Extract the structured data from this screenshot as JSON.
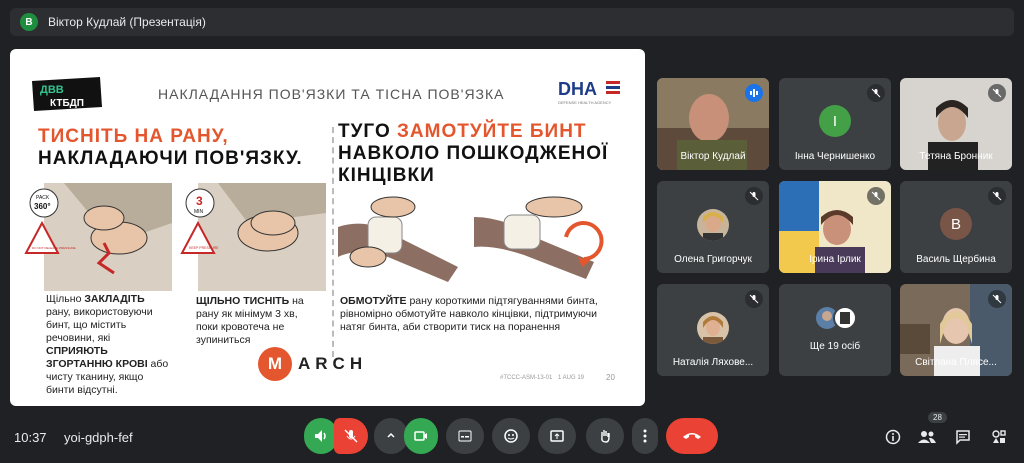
{
  "header": {
    "avatar_letter": "В",
    "title": "Віктор Кудлай (Презентація)"
  },
  "slide": {
    "logo_dvv_line1": "ДВВ",
    "logo_dvv_line2": "КТБДП",
    "title": "НАКЛАДАННЯ ПОВ'ЯЗКИ ТА ТІСНА ПОВ'ЯЗКА",
    "dha_logo": "DHA",
    "dha_sub": "DEFENSE HEALTH AGENCY",
    "left_heading_red": "ТИСНІТЬ НА РАНУ,",
    "left_heading_black": "НАКЛАДАЮЧИ ПОВ'ЯЗКУ.",
    "right_heading_black1": "ТУГО",
    "right_heading_red": "ЗАМОТУЙТЕ БИНТ",
    "right_heading_black2": "НАВКОЛО ПОШКОДЖЕНОЇ КІНЦІВКИ",
    "badge_pack": "PACK",
    "badge_360": "360°",
    "badge_3": "3",
    "badge_min": "MIN",
    "warn_left": "DO NOT RELEASE PRESSURE",
    "warn_right": "KEEP PRESSURE",
    "text1_a": "Щільно",
    "text1_b": "ЗАКЛАДІТЬ",
    "text1_c": "рану, використовуючи бинт, що містить речовини, які",
    "text1_d": "СПРИЯЮТЬ ЗГОРТАННЮ КРОВІ",
    "text1_e": "або чисту тканину, якщо бинти відсутні.",
    "text2_a": "ЩІЛЬНО ТИСНІТЬ",
    "text2_b": "на рану як мінімум 3 хв, поки кровотеча не зупиниться",
    "text3_a": "ОБМОТУЙТЕ",
    "text3_b": "рану короткими підтягуваннями бинта, рівномірно обмотуйте навколо кінцівки, підтримуючи натяг бинта, аби створити тиск на поранення",
    "march_m": "M",
    "march_rest": "ARCH",
    "footer_code": "#TCCC-ASM-13-01",
    "footer_date": "1 AUG 19",
    "page_number": "20"
  },
  "participants": [
    {
      "name": "Віктор Кудлай",
      "type": "video"
    },
    {
      "name": "Інна Чернишенко",
      "type": "letter",
      "letter": "І",
      "color": "#43a047"
    },
    {
      "name": "Тетяна Бронник",
      "type": "video"
    },
    {
      "name": "Олена Григорчук",
      "type": "photo"
    },
    {
      "name": "Ірина Ірлик",
      "type": "video"
    },
    {
      "name": "Василь Щербина",
      "type": "letter",
      "letter": "В",
      "color": "#795548"
    },
    {
      "name": "Наталія Ляхове...",
      "type": "photo"
    },
    {
      "name": "Ще 19 осіб",
      "type": "more"
    },
    {
      "name": "Світлана Плясе...",
      "type": "video"
    }
  ],
  "bottom": {
    "time": "10:37",
    "meeting_code": "yoi-gdph-fef",
    "people_count": "28"
  },
  "colors": {
    "accent_red": "#e4572e",
    "mic_green": "#34a853",
    "end_call": "#ea4335"
  }
}
